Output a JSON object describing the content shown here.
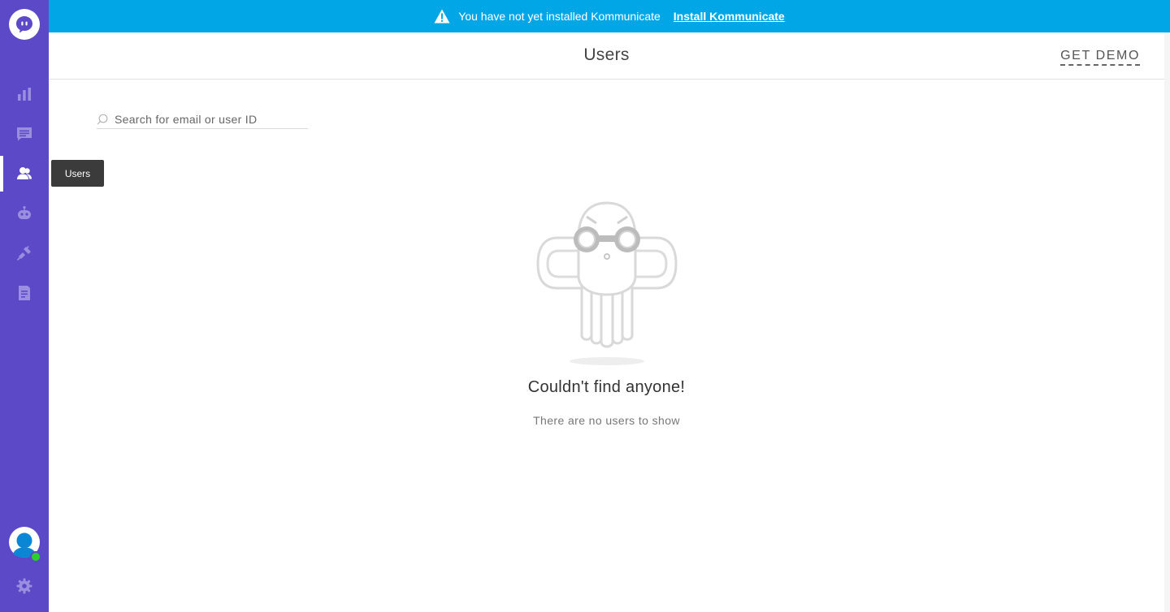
{
  "banner": {
    "message": "You have not yet installed Kommunicate",
    "link_label": "Install Kommunicate",
    "icon": "warning-icon"
  },
  "header": {
    "title": "Users",
    "demo_label": "GET DEMO"
  },
  "sidebar": {
    "items": [
      {
        "name": "dashboard",
        "icon": "bar-chart-icon"
      },
      {
        "name": "conversations",
        "icon": "chat-icon"
      },
      {
        "name": "users",
        "icon": "users-icon",
        "active": true
      },
      {
        "name": "bots",
        "icon": "bot-icon"
      },
      {
        "name": "integrations",
        "icon": "plug-icon"
      },
      {
        "name": "reports",
        "icon": "document-icon"
      }
    ],
    "settings_icon": "gear-icon"
  },
  "tooltip": {
    "text": "Users"
  },
  "search": {
    "placeholder": "Search for email or user ID",
    "value": ""
  },
  "empty_state": {
    "title": "Couldn't find anyone!",
    "subtitle": "There are no users to show"
  },
  "colors": {
    "sidebar": "#5c49c7",
    "banner": "#00a6e6",
    "online": "#2bd12b"
  }
}
